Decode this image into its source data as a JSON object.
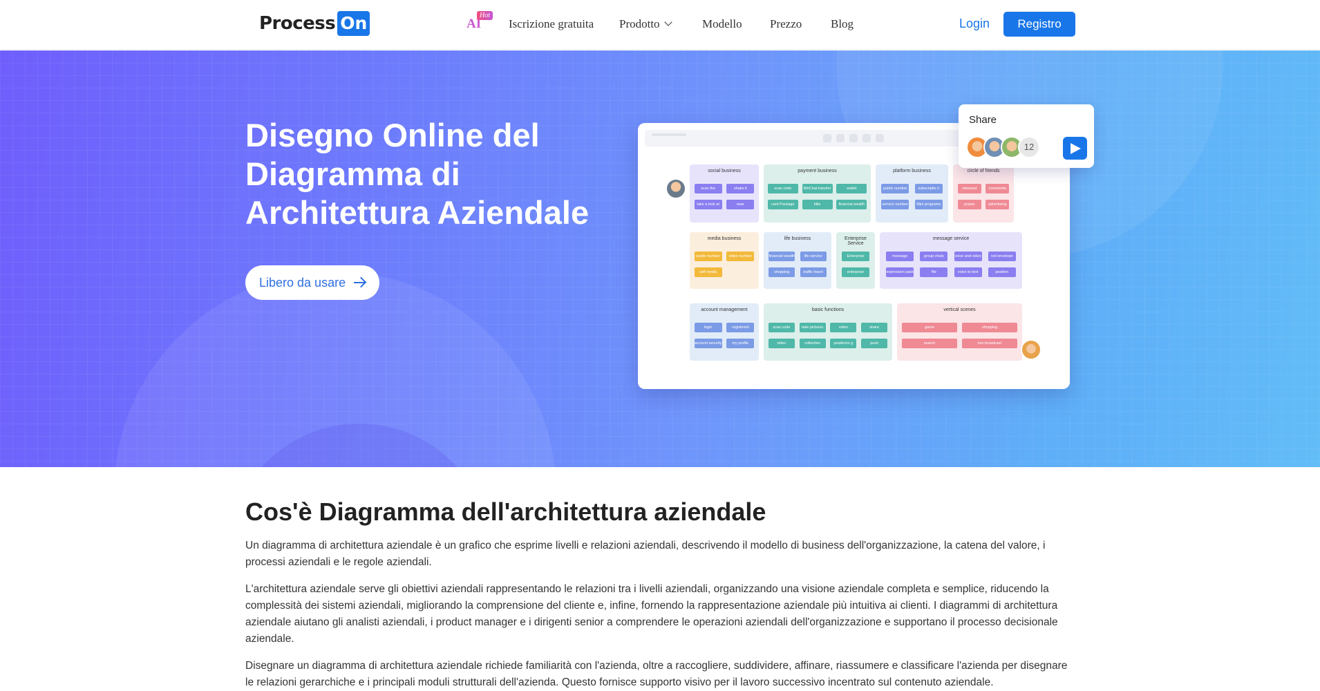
{
  "nav": {
    "logo_text": "Process",
    "logo_box": "On",
    "ai": "AI",
    "hot": "Hot",
    "links": [
      "Iscrizione gratuita",
      "Prodotto",
      "Modello",
      "Prezzo",
      "Blog"
    ],
    "login": "Login",
    "register": "Registro"
  },
  "hero": {
    "title": "Disegno Online del Diagramma di Architettura Aziendale",
    "button": "Libero da usare"
  },
  "mockup": {
    "groups": [
      {
        "title": "social business",
        "pills": [
          "scan the",
          "shake it",
          "take a look at",
          "near"
        ]
      },
      {
        "title": "payment business",
        "pills": [
          "scan code payment",
          "WeChat transfer",
          "wallet",
          "card Package",
          "bills",
          "financial wealth"
        ]
      },
      {
        "title": "platform business",
        "pills": [
          "public number",
          "subscriptio n number",
          "service number",
          "Mini programs"
        ]
      },
      {
        "title": "circle of friends",
        "pills": [
          "released",
          "comments",
          "praise",
          "advertising"
        ]
      },
      {
        "title": "media business",
        "pills": [
          "public number",
          "video number",
          "self media"
        ]
      },
      {
        "title": "life business",
        "pills": [
          "financial wealth",
          "life service",
          "shopping",
          "traffic travel"
        ]
      },
      {
        "title": "Enterprise Service",
        "pills": [
          "Enterprise WeChat",
          "enterprise number"
        ]
      },
      {
        "title": "message service",
        "pills": [
          "message",
          "group chats",
          "voice and video",
          "red envelope",
          "expression pack",
          "file",
          "voice to text",
          "position"
        ]
      },
      {
        "title": "account management",
        "pills": [
          "login",
          "registered",
          "account security",
          "my profile"
        ]
      },
      {
        "title": "basic functions",
        "pills": [
          "scan code",
          "take pictures",
          "video",
          "share",
          "video",
          "collection",
          "positionin g",
          "push"
        ]
      },
      {
        "title": "vertical scenes",
        "pills": [
          "game",
          "shopping",
          "search",
          "live broadcast"
        ]
      }
    ]
  },
  "share": {
    "title": "Share",
    "count": "12"
  },
  "content": {
    "heading": "Cos'è Diagramma dell'architettura aziendale",
    "p1": "Un diagramma di architettura aziendale è un grafico che esprime livelli e relazioni aziendali, descrivendo il modello di business dell'organizzazione, la catena del valore, i processi aziendali e le regole aziendali.",
    "p2": "L'architettura aziendale serve gli obiettivi aziendali rappresentando le relazioni tra i livelli aziendali, organizzando una visione aziendale completa e semplice, riducendo la complessità dei sistemi aziendali, migliorando la comprensione del cliente e, infine, fornendo la rappresentazione aziendale più intuitiva ai clienti. I diagrammi di architettura aziendale aiutano gli analisti aziendali, i product manager e i dirigenti senior a comprendere le operazioni aziendali dell'organizzazione e supportano il processo decisionale aziendale.",
    "p3": "Disegnare un diagramma di architettura aziendale richiede familiarità con l'azienda, oltre a raccogliere, suddividere, affinare, riassumere e classificare l'azienda per disegnare le relazioni gerarchiche e i principali moduli strutturali dell'azienda. Questo fornisce supporto visivo per il lavoro successivo incentrato sul contenuto aziendale."
  }
}
